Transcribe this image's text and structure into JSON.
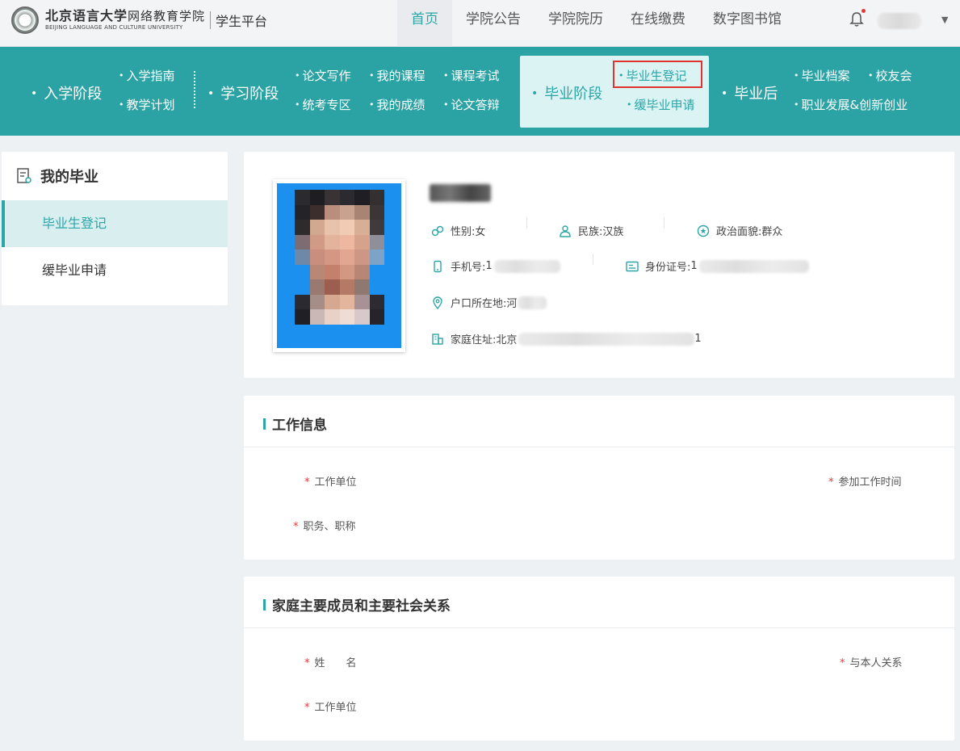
{
  "header": {
    "logo_cn": "北京语言大学",
    "logo_school": "网络教育学院",
    "logo_en": "BEIJING LANGUAGE AND CULTURE UNIVERSITY",
    "platform": "学生平台",
    "nav": [
      {
        "label": "首页",
        "active": true
      },
      {
        "label": "学院公告"
      },
      {
        "label": "学院院历"
      },
      {
        "label": "在线缴费"
      },
      {
        "label": "数字图书馆"
      }
    ],
    "icons": {
      "bell": "bell-icon",
      "caret": "caret-down-icon"
    }
  },
  "stages": {
    "enroll": {
      "label": "入学阶段",
      "subs": [
        "入学指南",
        "教学计划"
      ]
    },
    "study": {
      "label": "学习阶段",
      "subs": [
        "论文写作",
        "我的课程",
        "课程考试",
        "统考专区",
        "我的成绩",
        "论文答辩"
      ]
    },
    "graduate": {
      "label": "毕业阶段",
      "subs": [
        "毕业生登记",
        "缓毕业申请"
      ]
    },
    "after": {
      "label": "毕业后",
      "subs": [
        "毕业档案",
        "校友会",
        "职业发展&创新创业"
      ]
    }
  },
  "sidebar": {
    "title": "我的毕业",
    "items": [
      {
        "label": "毕业生登记",
        "active": true
      },
      {
        "label": "缓毕业申请"
      }
    ]
  },
  "profile": {
    "gender": {
      "label": "性别:",
      "value": "女"
    },
    "ethnicity": {
      "label": "民族:",
      "value": "汉族"
    },
    "political": {
      "label": "政治面貌:",
      "value": "群众"
    },
    "phone": {
      "label": "手机号:",
      "value": "1"
    },
    "id_card": {
      "label": "身份证号:",
      "value": "1"
    },
    "hukou": {
      "label": "户口所在地:",
      "value": "河"
    },
    "address": {
      "label": "家庭住址:",
      "value": "北京",
      "tail": "1"
    }
  },
  "work_section": {
    "title": "工作信息",
    "fields": {
      "unit": "工作单位",
      "start_time": "参加工作时间",
      "title": "职务、职称"
    }
  },
  "family_section": {
    "title": "家庭主要成员和主要社会关系",
    "fields": {
      "name": "姓　　名",
      "relation": "与本人关系",
      "unit": "工作单位"
    }
  },
  "required_mark": "*",
  "colors": {
    "teal": "#2ba3a4",
    "accent": "#2aa6a7",
    "highlight": "#e0322f",
    "required": "#e53935"
  }
}
